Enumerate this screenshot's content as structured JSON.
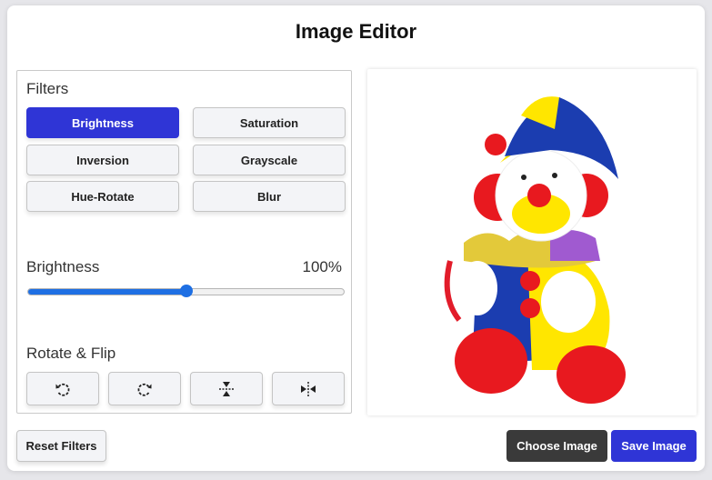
{
  "app": {
    "title": "Image Editor"
  },
  "filters": {
    "heading": "Filters",
    "buttons": [
      "Brightness",
      "Saturation",
      "Inversion",
      "Grayscale",
      "Hue-Rotate",
      "Blur"
    ],
    "active": "Brightness"
  },
  "slider": {
    "label": "Brightness",
    "value_text": "100%",
    "level_fraction": 0.5
  },
  "rotate": {
    "heading": "Rotate & Flip",
    "icons": [
      "rotate-left-icon",
      "rotate-right-icon",
      "flip-vertical-icon",
      "flip-horizontal-icon"
    ]
  },
  "actions": {
    "reset": "Reset Filters",
    "choose": "Choose Image",
    "save": "Save Image"
  },
  "colors": {
    "accent": "#2f35d6",
    "slider": "#1e6fe3",
    "dark_button": "#3a3a3a"
  }
}
